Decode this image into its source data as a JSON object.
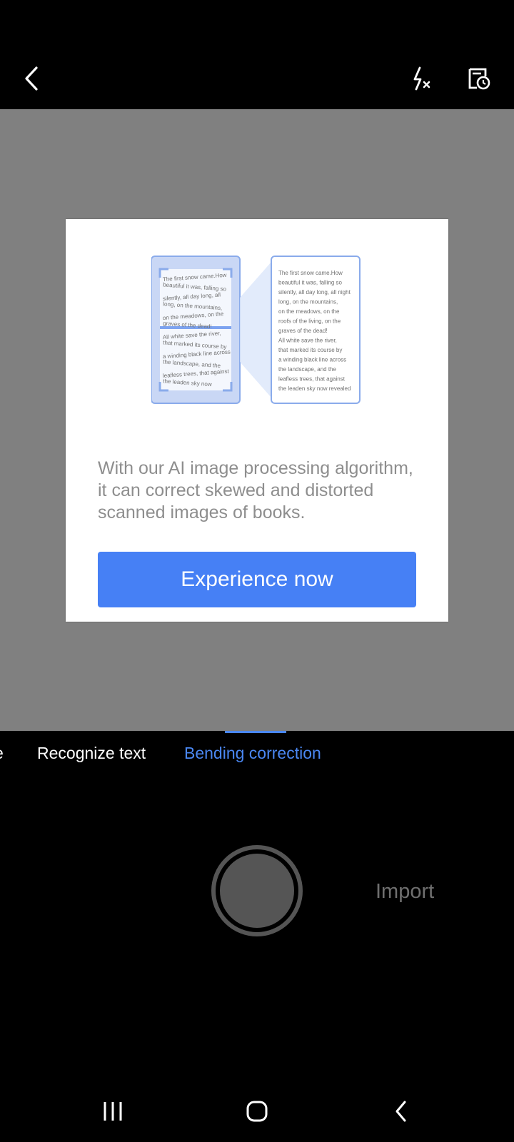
{
  "topbar": {
    "back_icon": "chevron-left-icon",
    "flash_icon": "flash-off-icon",
    "history_icon": "document-history-icon"
  },
  "dialog": {
    "left_sample_lines": [
      "The first snow came.How",
      "beautiful it was, falling so",
      "silently, all day long, all",
      "long, on the mountains,",
      "on the meadows, on the",
      "graves of the dead!",
      "All white save the river,",
      "that marked its course by",
      "a winding black line across",
      "the landscape, and the",
      "leafless trees, that against",
      "the leaden sky now"
    ],
    "right_sample_lines": [
      "The first snow came.How",
      "beautiful it was, falling so",
      "silently, all day long, all night",
      "long, on the mountains,",
      "on the meadows, on the",
      "roofs of the living, on the",
      "graves of the dead!",
      "All white save the river,",
      "that marked its course by",
      "a winding black line across",
      "the landscape, and the",
      "leafless trees, that against",
      "the leaden sky now revealed"
    ],
    "description": "With our AI image processing algorithm, it can correct skewed and distorted scanned images of books.",
    "button_label": "Experience now"
  },
  "modes": {
    "partial_label": "e",
    "recognize_label": "Recognize text",
    "active_label": "Bending correction"
  },
  "camera": {
    "import_label": "Import"
  },
  "navbar": {
    "recent_icon": "recent-apps-icon",
    "home_icon": "home-icon",
    "back_icon": "back-icon"
  },
  "colors": {
    "accent": "#4a87f2",
    "button": "#4680f5",
    "overlay": "#808080"
  }
}
